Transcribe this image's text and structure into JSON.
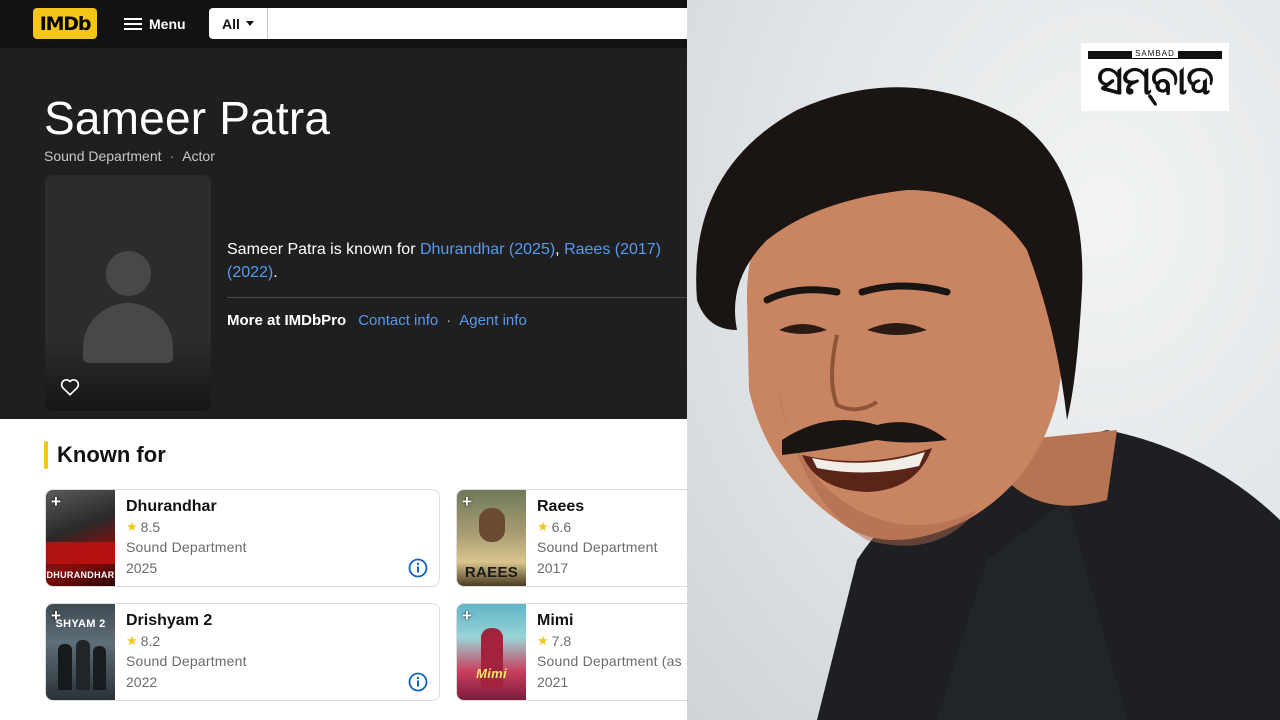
{
  "header": {
    "logo_text": "IMDb",
    "menu_label": "Menu",
    "search_category": "All",
    "search_placeholder": ""
  },
  "profile": {
    "name": "Sameer Patra",
    "roles": [
      "Sound Department",
      "Actor"
    ],
    "role_separator": "·",
    "bio_prefix": "Sameer Patra is known for ",
    "bio_link_1": "Dhurandhar (2025)",
    "bio_comma": ", ",
    "bio_link_2": "Raees (2017)",
    "bio_link_3": "(2022)",
    "bio_period": ".",
    "pro_label": "More at IMDbPro",
    "contact_label": "Contact info",
    "pro_separator": "·",
    "agent_label": "Agent info"
  },
  "known_for": {
    "title": "Known for",
    "cards": [
      {
        "title": "Dhurandhar",
        "rating": "8.5",
        "role": "Sound Department",
        "year": "2025",
        "poster_text": "DHURANDHAR"
      },
      {
        "title": "Raees",
        "rating": "6.6",
        "role": "Sound Department",
        "year": "2017",
        "poster_text": "RAEES"
      },
      {
        "title": "Drishyam 2",
        "rating": "8.2",
        "role": "Sound Department",
        "year": "2022",
        "poster_text": "SHYAM 2"
      },
      {
        "title": "Mimi",
        "rating": "7.8",
        "role": "Sound Department (as S",
        "year": "2021",
        "poster_text": "Mimi"
      }
    ]
  },
  "watermark": {
    "small": "SAMBAD",
    "big": "ସମ୍ବାଦ"
  },
  "colors": {
    "imdb_yellow": "#f5c518",
    "link_blue": "#5799ef",
    "hero_bg": "#1f1f1f",
    "topbar_bg": "#121212"
  },
  "icons": [
    "menu-icon",
    "caret-down-icon",
    "user-silhouette-icon",
    "heart-icon",
    "star-icon",
    "info-icon",
    "plus-icon"
  ]
}
